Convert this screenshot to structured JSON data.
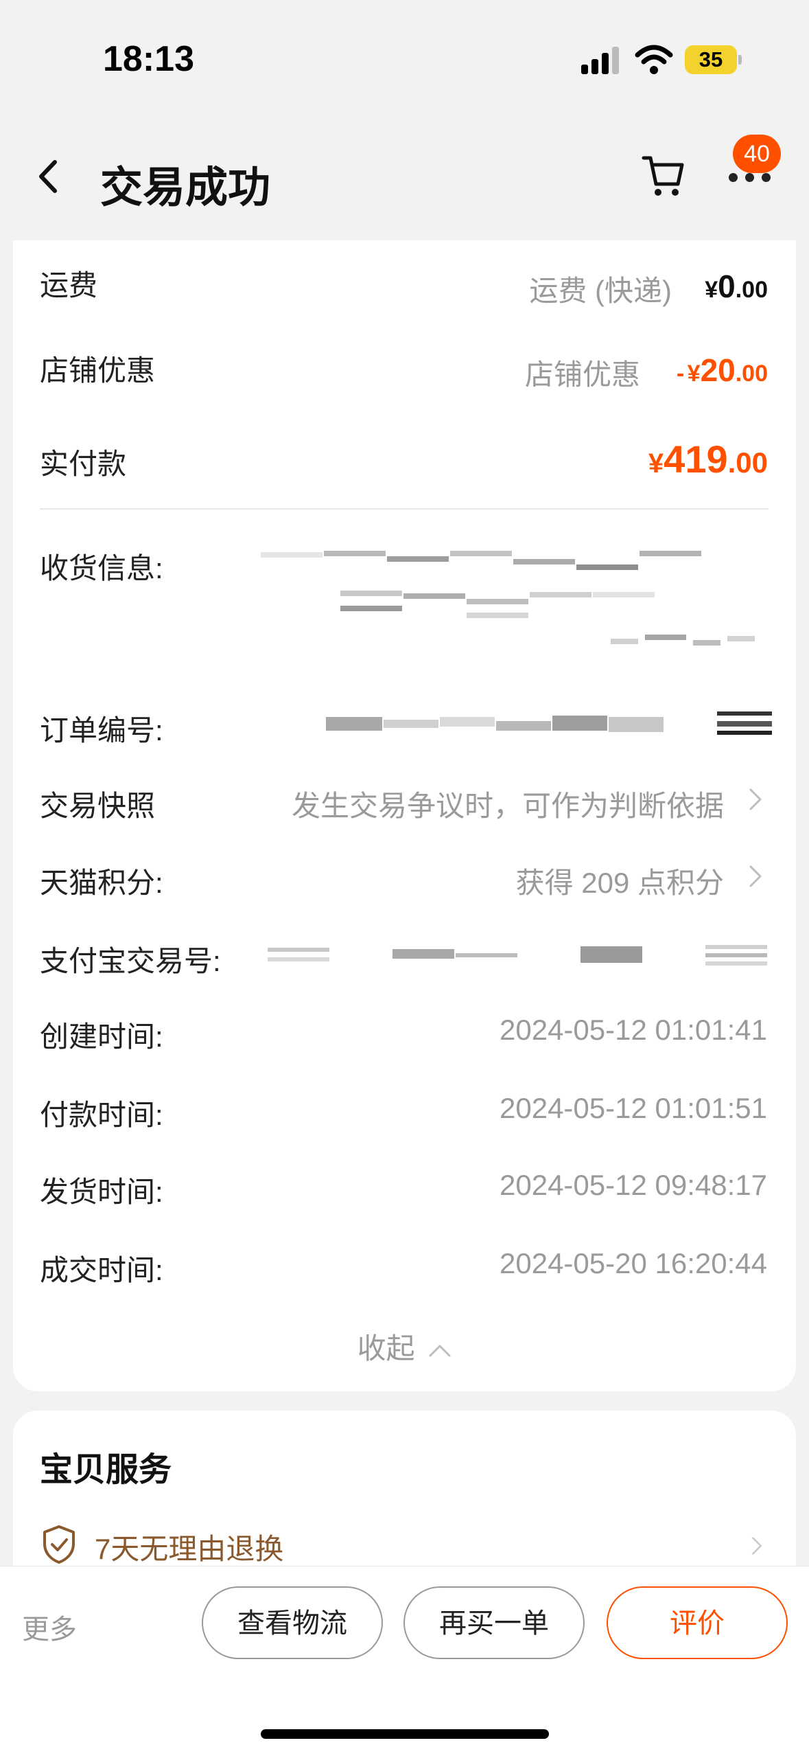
{
  "status_bar": {
    "time": "18:13",
    "battery": "35"
  },
  "header": {
    "title": "交易成功",
    "badge": "40"
  },
  "payment": {
    "shipping_label": "运费",
    "shipping_desc": "运费 (快递)",
    "shipping_currency": "¥",
    "shipping_int": "0",
    "shipping_dec": ".00",
    "discount_label": "店铺优惠",
    "discount_desc": "店铺优惠",
    "discount_prefix": "-",
    "discount_currency": "¥",
    "discount_int": "20",
    "discount_dec": ".00",
    "paid_label": "实付款",
    "paid_currency": "¥",
    "paid_int": "419",
    "paid_dec": ".00"
  },
  "order_info": {
    "address_label": "收货信息:",
    "order_no_label": "订单编号:",
    "snapshot_label": "交易快照",
    "snapshot_value": "发生交易争议时，可作为判断依据",
    "points_label": "天猫积分:",
    "points_value": "获得 209 点积分",
    "alipay_label": "支付宝交易号:",
    "created_label": "创建时间:",
    "created_value": "2024-05-12 01:01:41",
    "paid_time_label": "付款时间:",
    "paid_time_value": "2024-05-12 01:01:51",
    "shipped_label": "发货时间:",
    "shipped_value": "2024-05-12 09:48:17",
    "closed_label": "成交时间:",
    "closed_value": "2024-05-20 16:20:44",
    "collapse_label": "收起"
  },
  "service": {
    "title": "宝贝服务",
    "guarantee": "7天无理由退换"
  },
  "bottom_bar": {
    "more": "更多",
    "logistics": "查看物流",
    "rebuy": "再买一单",
    "review": "评价"
  },
  "colors": {
    "accent": "#ff5000",
    "muted": "#9a9a9a",
    "brown": "#8a5a2e"
  },
  "icons": [
    "back-icon",
    "cart-icon",
    "more-icon",
    "chevron-right-icon",
    "chevron-up-icon",
    "shield-check-icon",
    "signal-icon",
    "wifi-icon"
  ]
}
